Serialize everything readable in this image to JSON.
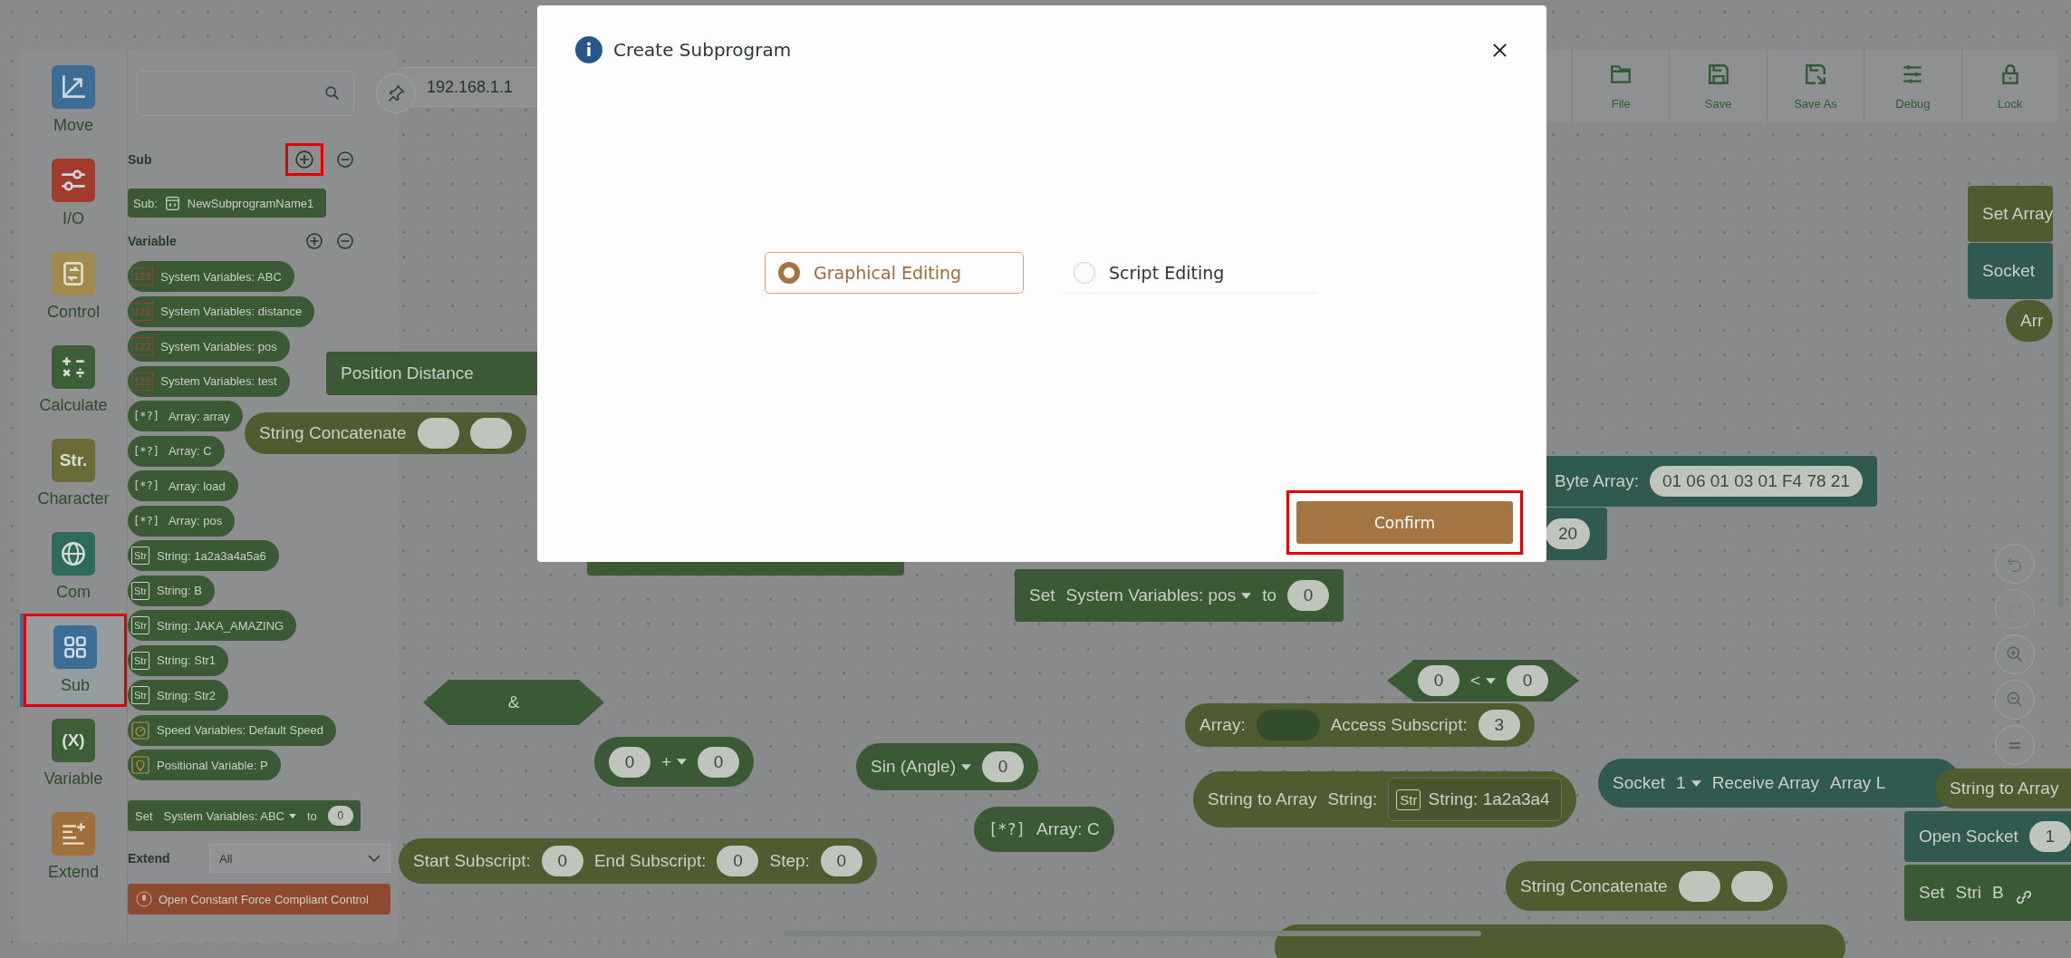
{
  "categories": [
    {
      "kind": "move",
      "label": "Move",
      "color": "#3c6d94",
      "selected": false,
      "highlighted": false
    },
    {
      "kind": "io",
      "label": "I/O",
      "color": "#a23b2c",
      "selected": false,
      "highlighted": false
    },
    {
      "kind": "control",
      "label": "Control",
      "color": "#a08a4e",
      "selected": false,
      "highlighted": false
    },
    {
      "kind": "calculate",
      "label": "Calculate",
      "color": "#3e5e38",
      "selected": false,
      "highlighted": false
    },
    {
      "kind": "character",
      "label": "Character",
      "glyph": "Str.",
      "color": "#6b6b38",
      "selected": false,
      "highlighted": false
    },
    {
      "kind": "com",
      "label": "Com",
      "color": "#2f6a5e",
      "selected": false,
      "highlighted": false
    },
    {
      "kind": "sub",
      "label": "Sub",
      "color": "#3c6d94",
      "selected": true,
      "highlighted": true
    },
    {
      "kind": "variable",
      "label": "Variable",
      "glyph": "(X)",
      "color": "#3e5e38",
      "selected": false,
      "highlighted": false
    },
    {
      "kind": "extend",
      "label": "Extend",
      "color": "#a0703a",
      "selected": false,
      "highlighted": false
    }
  ],
  "palette": {
    "sub_section": {
      "title": "Sub",
      "add_highlighted": true,
      "blocks": [
        {
          "prefix": "Sub:",
          "name": "NewSubprogramName1"
        }
      ]
    },
    "variable_section": {
      "title": "Variable",
      "items": [
        {
          "kind": "system",
          "badge": "123",
          "text": "System Variables:  ABC"
        },
        {
          "kind": "system",
          "badge": "123",
          "text": "System Variables:  distance"
        },
        {
          "kind": "system",
          "badge": "123",
          "text": "System Variables:  pos"
        },
        {
          "kind": "system",
          "badge": "123",
          "text": "System Variables:  test"
        },
        {
          "kind": "array",
          "badge": "[*?]",
          "text": "Array:  array"
        },
        {
          "kind": "array",
          "badge": "[*?]",
          "text": "Array:  C"
        },
        {
          "kind": "array",
          "badge": "[*?]",
          "text": "Array:  load"
        },
        {
          "kind": "array",
          "badge": "[*?]",
          "text": "Array:  pos"
        },
        {
          "kind": "string",
          "badge": "Str",
          "text": "String:  1a2a3a4a5a6"
        },
        {
          "kind": "string",
          "badge": "Str",
          "text": "String:  B"
        },
        {
          "kind": "string",
          "badge": "Str",
          "text": "String:  JAKA_AMAZING"
        },
        {
          "kind": "string",
          "badge": "Str",
          "text": "String:  Str1"
        },
        {
          "kind": "string",
          "badge": "Str",
          "text": "String:  Str2"
        },
        {
          "kind": "speed",
          "text": "Speed Variables:  Default Speed"
        },
        {
          "kind": "position",
          "text": "Positional Variable:  P"
        }
      ]
    },
    "set_block": {
      "label": "Set",
      "variable": "System Variables: ABC",
      "to": "to",
      "value": "0"
    },
    "extend": {
      "label": "Extend",
      "value": "All",
      "blocks": [
        "Open Constant Force Compliant Control"
      ]
    }
  },
  "ip_address": "192.168.1.1",
  "toolbar": [
    {
      "kind": "file",
      "label": "File"
    },
    {
      "kind": "save",
      "label": "Save"
    },
    {
      "kind": "save_as",
      "label": "Save As"
    },
    {
      "kind": "debug",
      "label": "Debug"
    },
    {
      "kind": "lock",
      "label": "Lock"
    }
  ],
  "canvas_blocks": [
    {
      "kind": "stack",
      "color": "#3a5934",
      "parts": [
        {
          "kind": "text",
          "text": "Position Distance"
        }
      ]
    },
    {
      "kind": "pill",
      "color": "#4f5c30",
      "parts": [
        {
          "kind": "text",
          "text": "String Concatenate"
        },
        {
          "kind": "slot"
        },
        {
          "kind": "slot"
        }
      ]
    },
    {
      "kind": "stack",
      "color": "#3a5934"
    },
    {
      "kind": "stack",
      "color": "#30594f",
      "parts": [
        {
          "kind": "text",
          "text": "Byte Array:"
        },
        {
          "kind": "slot",
          "text": "01 06 01 03 01 F4 78 21"
        }
      ]
    },
    {
      "kind": "stack",
      "color": "#30594f",
      "parts": [
        {
          "kind": "slot",
          "text": "20"
        }
      ]
    },
    {
      "kind": "stack",
      "color": "#3a5934",
      "parts": [
        {
          "kind": "text",
          "text": "Set"
        },
        {
          "kind": "dropdown",
          "text": "System Variables: pos"
        },
        {
          "kind": "text",
          "text": "to"
        },
        {
          "kind": "slot",
          "text": "0"
        }
      ]
    },
    {
      "kind": "hex",
      "color": "#3a5934",
      "parts": [
        {
          "kind": "text",
          "text": "&"
        }
      ]
    },
    {
      "kind": "hex",
      "color": "#3a5934",
      "parts": [
        {
          "kind": "slot",
          "text": "0"
        },
        {
          "kind": "dropdown",
          "text": "<"
        },
        {
          "kind": "slot",
          "text": "0"
        }
      ]
    },
    {
      "kind": "pill",
      "color": "#4f5c30",
      "parts": [
        {
          "kind": "text",
          "text": "Array:"
        },
        {
          "kind": "hole"
        },
        {
          "kind": "text",
          "text": "Access Subscript:"
        },
        {
          "kind": "slot",
          "text": "3"
        }
      ]
    },
    {
      "kind": "pill",
      "color": "#3a5934",
      "parts": [
        {
          "kind": "slot",
          "text": "0"
        },
        {
          "kind": "dropdown",
          "text": "+"
        },
        {
          "kind": "slot",
          "text": "0"
        }
      ]
    },
    {
      "kind": "pill",
      "color": "#3a5934",
      "parts": [
        {
          "kind": "dropdown",
          "text": "Sin (Angle)"
        },
        {
          "kind": "slot",
          "text": "0"
        }
      ]
    },
    {
      "kind": "pill",
      "color": "#4f5c30",
      "parts": [
        {
          "kind": "text",
          "text": "String to Array"
        },
        {
          "kind": "text",
          "text": "String:"
        },
        {
          "kind": "var",
          "badge": "Str",
          "text": "String:  1a2a3a4"
        }
      ]
    },
    {
      "kind": "pill",
      "color": "#30594f",
      "parts": [
        {
          "kind": "text",
          "text": "Socket"
        },
        {
          "kind": "dropdown",
          "text": "1"
        },
        {
          "kind": "text",
          "text": "Receive Array"
        },
        {
          "kind": "text",
          "text": "Array L"
        }
      ]
    },
    {
      "kind": "pill",
      "color": "#4f5c30",
      "parts": [
        {
          "kind": "text",
          "text": "String to Array"
        }
      ]
    },
    {
      "kind": "pill",
      "color": "#3a5934",
      "parts": [
        {
          "kind": "badge",
          "text": "[*?]"
        },
        {
          "kind": "text",
          "text": "Array:  C"
        }
      ]
    },
    {
      "kind": "pill",
      "color": "#4f5c30",
      "parts": [
        {
          "kind": "text",
          "text": "Start Subscript:"
        },
        {
          "kind": "slot",
          "text": "0"
        },
        {
          "kind": "text",
          "text": "End Subscript:"
        },
        {
          "kind": "slot",
          "text": "0"
        },
        {
          "kind": "text",
          "text": "Step:"
        },
        {
          "kind": "slot",
          "text": "0"
        }
      ]
    },
    {
      "kind": "pill",
      "color": "#4f5c30",
      "parts": [
        {
          "kind": "text",
          "text": "String Concatenate"
        },
        {
          "kind": "slot"
        },
        {
          "kind": "slot"
        }
      ]
    },
    {
      "kind": "pill",
      "color": "#4f5c30"
    },
    {
      "kind": "stack",
      "color": "#4f5c30",
      "parts": [
        {
          "kind": "text",
          "text": "Set Array"
        }
      ]
    },
    {
      "kind": "stack",
      "color": "#30594f",
      "parts": [
        {
          "kind": "text",
          "text": "Socket"
        }
      ]
    },
    {
      "kind": "pill",
      "color": "#4f5c30",
      "parts": [
        {
          "kind": "text",
          "text": "Arr"
        }
      ]
    },
    {
      "kind": "stack",
      "color": "#30594f",
      "parts": [
        {
          "kind": "text",
          "text": "Open Socket"
        },
        {
          "kind": "slot",
          "text": "1"
        }
      ]
    },
    {
      "kind": "stack",
      "color": "#3a5934",
      "parts": [
        {
          "kind": "text",
          "text": "Set"
        },
        {
          "kind": "text",
          "text": "Stri"
        },
        {
          "kind": "text",
          "text": "B"
        }
      ]
    }
  ],
  "modal": {
    "title": "Create Subprogram",
    "options": [
      {
        "label": "Graphical Editing",
        "selected": true
      },
      {
        "label": "Script Editing",
        "selected": false
      }
    ],
    "confirm": {
      "label": "Confirm",
      "highlighted": true
    }
  }
}
